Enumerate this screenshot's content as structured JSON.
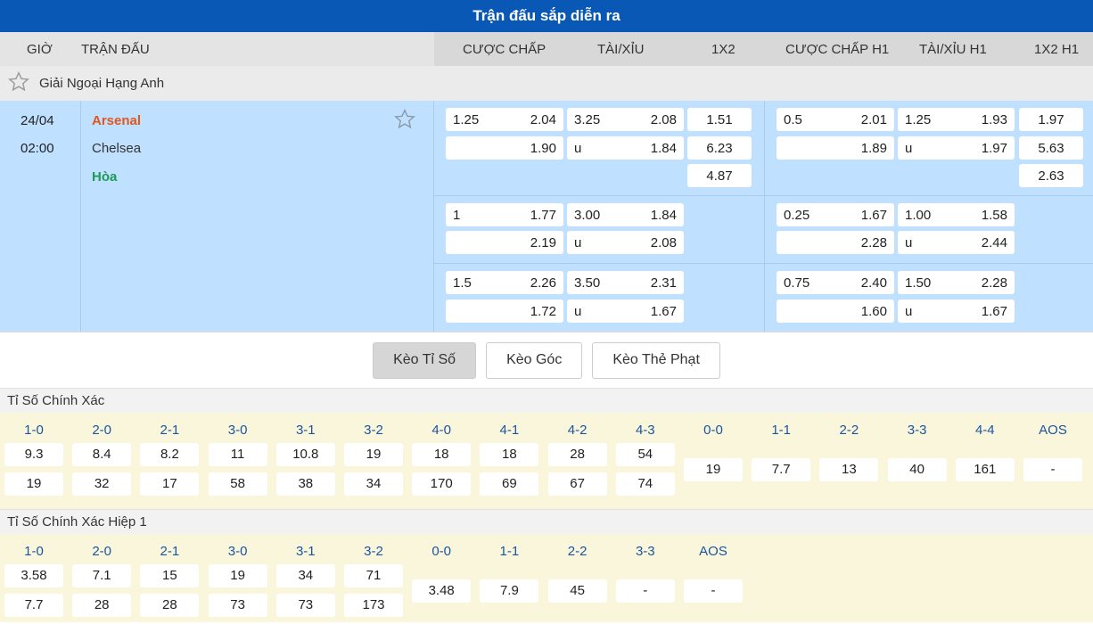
{
  "title": "Trận đấu sắp diễn ra",
  "headers": [
    "GIỜ",
    "TRẬN ĐẤU",
    "CƯỢC CHẤP",
    "TÀI/XỈU",
    "1X2",
    "CƯỢC CHẤP H1",
    "TÀI/XỈU H1",
    "1X2 H1"
  ],
  "league": "Giải Ngoại Hạng Anh",
  "match": {
    "date": "24/04",
    "time": "02:00",
    "home": "Arsenal",
    "away": "Chelsea",
    "draw": "Hòa",
    "rows": [
      {
        "hcp": [
          "1.25",
          "2.04",
          "",
          "1.90"
        ],
        "ou": [
          "3.25",
          "2.08",
          "u",
          "1.84"
        ],
        "x12": [
          "1.51",
          "6.23",
          "4.87"
        ],
        "hcp1": [
          "0.5",
          "2.01",
          "",
          "1.89"
        ],
        "ou1": [
          "1.25",
          "1.93",
          "u",
          "1.97"
        ],
        "x121": [
          "1.97",
          "5.63",
          "2.63"
        ]
      },
      {
        "hcp": [
          "1",
          "1.77",
          "",
          "2.19"
        ],
        "ou": [
          "3.00",
          "1.84",
          "u",
          "2.08"
        ],
        "hcp1": [
          "0.25",
          "1.67",
          "",
          "2.28"
        ],
        "ou1": [
          "1.00",
          "1.58",
          "u",
          "2.44"
        ]
      },
      {
        "hcp": [
          "1.5",
          "2.26",
          "",
          "1.72"
        ],
        "ou": [
          "3.50",
          "2.31",
          "u",
          "1.67"
        ],
        "hcp1": [
          "0.75",
          "2.40",
          "",
          "1.60"
        ],
        "ou1": [
          "1.50",
          "2.28",
          "u",
          "1.67"
        ]
      }
    ]
  },
  "tabs": [
    "Kèo Tỉ Số",
    "Kèo Góc",
    "Kèo Thẻ Phạt"
  ],
  "correct_score": {
    "title": "Tỉ Số Chính Xác",
    "pairs": [
      [
        "1-0",
        "9.3",
        "19"
      ],
      [
        "2-0",
        "8.4",
        "32"
      ],
      [
        "2-1",
        "8.2",
        "17"
      ],
      [
        "3-0",
        "11",
        "58"
      ],
      [
        "3-1",
        "10.8",
        "38"
      ],
      [
        "3-2",
        "19",
        "34"
      ],
      [
        "4-0",
        "18",
        "170"
      ],
      [
        "4-1",
        "18",
        "69"
      ],
      [
        "4-2",
        "28",
        "67"
      ],
      [
        "4-3",
        "54",
        "74"
      ]
    ],
    "singles": [
      [
        "0-0",
        "19"
      ],
      [
        "1-1",
        "7.7"
      ],
      [
        "2-2",
        "13"
      ],
      [
        "3-3",
        "40"
      ],
      [
        "4-4",
        "161"
      ],
      [
        "AOS",
        "-"
      ]
    ]
  },
  "ht_score": {
    "title": "Tỉ Số Chính Xác Hiệp 1",
    "pairs": [
      [
        "1-0",
        "3.58",
        "7.7"
      ],
      [
        "2-0",
        "7.1",
        "28"
      ],
      [
        "2-1",
        "15",
        "28"
      ],
      [
        "3-0",
        "19",
        "73"
      ],
      [
        "3-1",
        "34",
        "73"
      ],
      [
        "3-2",
        "71",
        "173"
      ]
    ],
    "singles": [
      [
        "0-0",
        "3.48"
      ],
      [
        "1-1",
        "7.9"
      ],
      [
        "2-2",
        "45"
      ],
      [
        "3-3",
        "-"
      ],
      [
        "AOS",
        "-"
      ]
    ]
  }
}
